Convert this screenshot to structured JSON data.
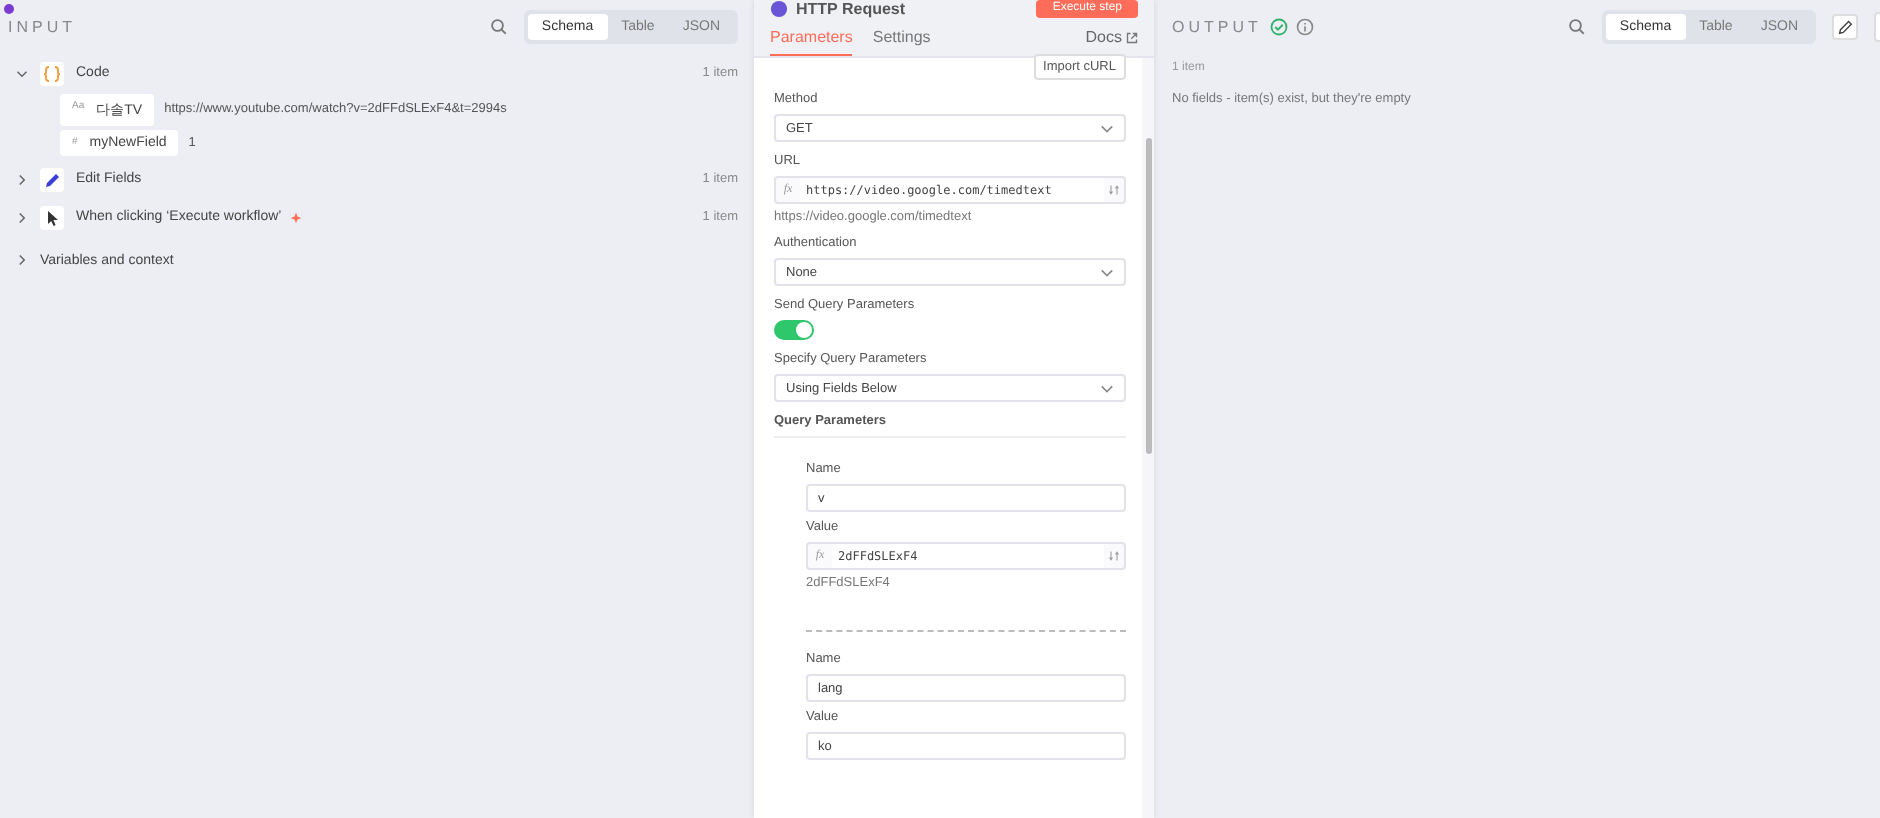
{
  "input": {
    "title": "INPUT",
    "view_tabs": [
      {
        "label": "Schema",
        "selected": true
      },
      {
        "label": "Table",
        "selected": false
      },
      {
        "label": "JSON",
        "selected": false
      }
    ],
    "nodes": [
      {
        "name": "Code",
        "kind": "code",
        "count": "1 item",
        "expanded": true,
        "trigger": false,
        "fields": [
          {
            "type": "Aa",
            "name": "다솔TV",
            "value": "https://www.youtube.com/watch?v=2dFFdSLExF4&t=2994s"
          },
          {
            "type": "#",
            "name": "myNewField",
            "value": "1"
          }
        ]
      },
      {
        "name": "Edit Fields",
        "kind": "edit",
        "count": "1 item",
        "expanded": false,
        "trigger": false
      },
      {
        "name": "When clicking ‘Execute workflow’",
        "kind": "trigger",
        "count": "1 item",
        "expanded": false,
        "trigger": true
      }
    ],
    "variables_label": "Variables and context"
  },
  "node": {
    "title": "HTTP Request",
    "execute_label": "Execute step",
    "tabs": [
      {
        "label": "Parameters",
        "selected": true
      },
      {
        "label": "Settings",
        "selected": false
      }
    ],
    "docs_label": "Docs",
    "import_label": "Import cURL",
    "fields": [
      {
        "kind": "select",
        "label": "Method",
        "value": "GET"
      },
      {
        "kind": "expression",
        "label": "URL",
        "fx": "fx",
        "value": "https://video.google.com/timedtext",
        "hint": "https://video.google.com/timedtext"
      },
      {
        "kind": "select",
        "label": "Authentication",
        "value": "None"
      },
      {
        "kind": "toggle",
        "label": "Send Query Parameters",
        "on": true
      },
      {
        "kind": "select",
        "label": "Specify Query Parameters",
        "value": "Using Fields Below"
      }
    ],
    "params_title": "Query Parameters",
    "params": [
      {
        "name_label": "Name",
        "name": "v",
        "value_label": "Value",
        "fx": "fx",
        "value": "2dFFdSLExF4",
        "expression": true,
        "hint": "2dFFdSLExF4"
      },
      {
        "name_label": "Name",
        "name": "lang",
        "value_label": "Value",
        "value": "ko",
        "expression": false
      }
    ]
  },
  "output": {
    "title": "OUTPUT",
    "success": true,
    "view_tabs": [
      {
        "label": "Schema",
        "selected": true
      },
      {
        "label": "Table",
        "selected": false
      },
      {
        "label": "JSON",
        "selected": false
      }
    ],
    "count": "1 item",
    "message": "No fields - item(s) exist, but they're empty"
  }
}
